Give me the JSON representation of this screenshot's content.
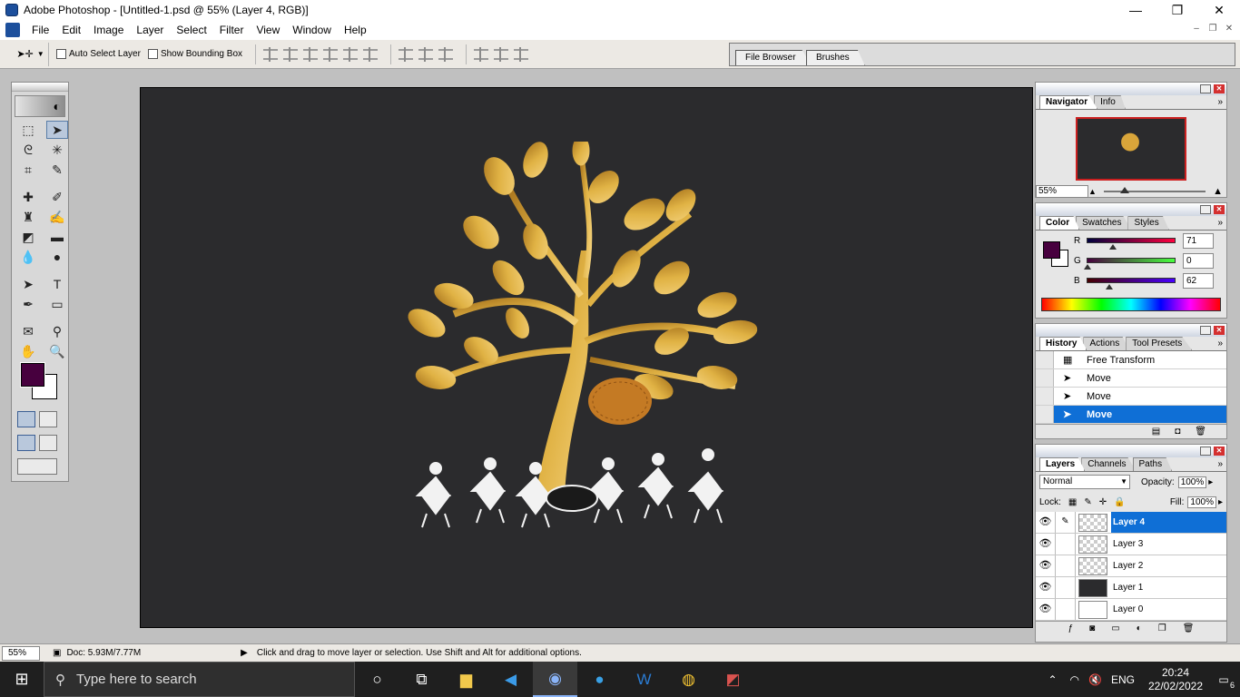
{
  "window": {
    "title": "Adobe Photoshop - [Untitled-1.psd @ 55% (Layer 4, RGB)]",
    "minimize": "—",
    "maximize": "❐",
    "close": "✕"
  },
  "menu": [
    "File",
    "Edit",
    "Image",
    "Layer",
    "Select",
    "Filter",
    "View",
    "Window",
    "Help"
  ],
  "options": {
    "auto_select_layer": "Auto Select Layer",
    "show_bounding_box": "Show Bounding Box"
  },
  "well_tabs": [
    "File Browser",
    "Brushes"
  ],
  "toolbox": {
    "foreground_color": "#47003e",
    "background_color": "#ffffff"
  },
  "navigator": {
    "tabs": [
      "Navigator",
      "Info"
    ],
    "zoom": "55%"
  },
  "color": {
    "tabs": [
      "Color",
      "Swatches",
      "Styles"
    ],
    "labels": [
      "R",
      "G",
      "B"
    ],
    "values": [
      "71",
      "0",
      "62"
    ]
  },
  "history": {
    "tabs": [
      "History",
      "Actions",
      "Tool Presets"
    ],
    "items": [
      "Free Transform",
      "Move",
      "Move",
      "Move"
    ]
  },
  "layers": {
    "tabs": [
      "Layers",
      "Channels",
      "Paths"
    ],
    "blend_mode": "Normal",
    "opacity_label": "Opacity:",
    "opacity": "100%",
    "lock_label": "Lock:",
    "fill_label": "Fill:",
    "fill": "100%",
    "items": [
      "Layer 4",
      "Layer 3",
      "Layer 2",
      "Layer 1",
      "Layer 0"
    ]
  },
  "status": {
    "zoom": "55%",
    "doc": "Doc: 5.93M/7.77M",
    "hint": "Click and drag to move layer or selection.  Use Shift and Alt for additional options."
  },
  "taskbar": {
    "search_placeholder": "Type here to search",
    "language": "ENG",
    "time": "20:24",
    "date": "22/02/2022",
    "notifications": "6"
  }
}
